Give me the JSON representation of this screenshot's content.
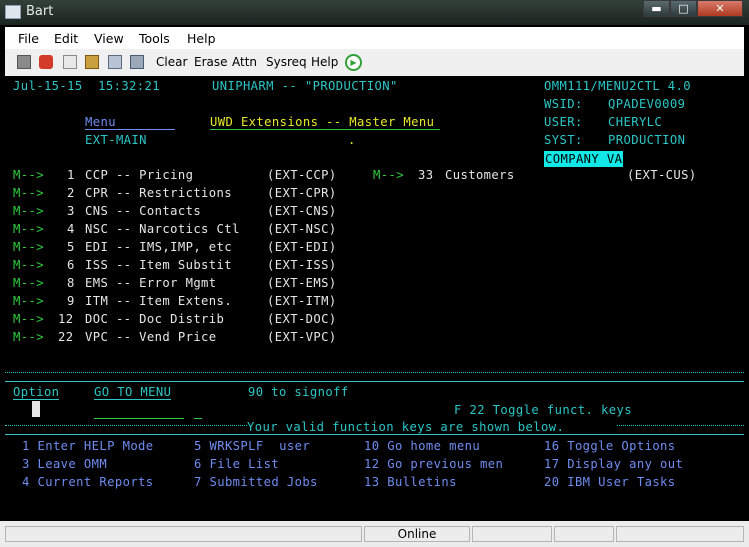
{
  "window": {
    "title": "Bart",
    "buttons": {
      "minimize": "▬",
      "maximize": "□",
      "close": "✕"
    }
  },
  "menubar": {
    "items": [
      "File",
      "Edit",
      "View",
      "Tools",
      "Help"
    ]
  },
  "toolbar": {
    "buttons": [
      "Clear",
      "Erase",
      "Attn",
      "Sysreq",
      "Help"
    ],
    "icons": [
      "window-icon",
      "tools-icon",
      "copy-icon",
      "paste-icon",
      "print-icon",
      "print-screen-icon",
      "play-icon"
    ]
  },
  "terminal": {
    "header": {
      "datetime": "Jul-15-15  15:32:21",
      "system_name": "UNIPHARM -- \"PRODUCTION\"",
      "program": "OMM111/MENU2CTL 4.0",
      "wsid_label": "WSID:",
      "wsid": "QPADEV0009",
      "user_label": "USER:",
      "user": "CHERYLC",
      "syst_label": "SYST:",
      "syst": "PRODUCTION",
      "company": "COMPANY VA"
    },
    "menu_label": "Menu",
    "menu_name": "EXT-MAIN",
    "menu_title": "UWD Extensions -- Master Menu",
    "dot": ".",
    "menu_items": [
      {
        "arrow": "M-->",
        "num": "1",
        "text": "CCP -- Pricing",
        "code": "(EXT-CCP)"
      },
      {
        "arrow": "M-->",
        "num": "2",
        "text": "CPR -- Restrictions",
        "code": "(EXT-CPR)"
      },
      {
        "arrow": "M-->",
        "num": "3",
        "text": "CNS -- Contacts",
        "code": "(EXT-CNS)"
      },
      {
        "arrow": "M-->",
        "num": "4",
        "text": "NSC -- Narcotics Ctl",
        "code": "(EXT-NSC)"
      },
      {
        "arrow": "M-->",
        "num": "5",
        "text": "EDI -- IMS,IMP, etc",
        "code": "(EXT-EDI)"
      },
      {
        "arrow": "M-->",
        "num": "6",
        "text": "ISS -- Item Substit",
        "code": "(EXT-ISS)"
      },
      {
        "arrow": "M-->",
        "num": "8",
        "text": "EMS -- Error Mgmt",
        "code": "(EXT-EMS)"
      },
      {
        "arrow": "M-->",
        "num": "9",
        "text": "ITM -- Item Extens.",
        "code": "(EXT-ITM)"
      },
      {
        "arrow": "M-->",
        "num": "12",
        "text": "DOC -- Doc Distrib",
        "code": "(EXT-DOC)"
      },
      {
        "arrow": "M-->",
        "num": "22",
        "text": "VPC -- Vend Price",
        "code": "(EXT-VPC)"
      }
    ],
    "menu_item_right": {
      "arrow": "M-->",
      "num": "33",
      "text": "Customers",
      "code": "(EXT-CUS)"
    },
    "option_label": "Option",
    "goto_label": "GO TO MENU",
    "signoff": "90 to signoff",
    "toggle_keys": "F 22 Toggle funct. keys",
    "valid_keys": "Your valid function keys are shown below.",
    "function_keys": [
      [
        "1 Enter HELP Mode",
        "5 WRKSPLF  user",
        "10 Go home menu",
        "16 Toggle Options"
      ],
      [
        "3 Leave OMM",
        "6 File List",
        "12 Go previous men",
        "17 Display any out"
      ],
      [
        "4 Current Reports",
        "7 Submitted Jobs",
        "13 Bulletins",
        "20 IBM User Tasks"
      ]
    ]
  },
  "statusbar": {
    "status": "Online"
  }
}
